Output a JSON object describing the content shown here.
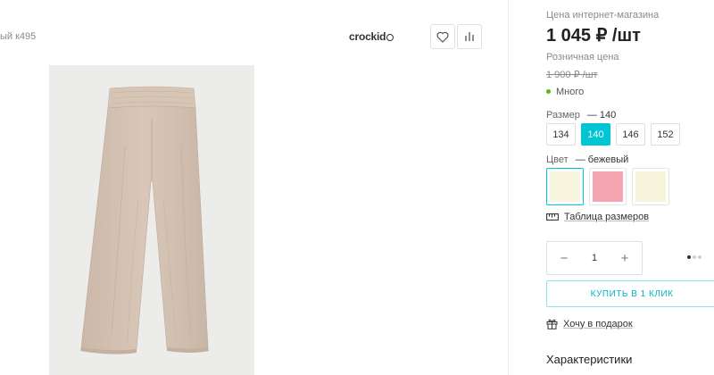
{
  "product": {
    "article_partial": "ый к495",
    "brand": "crockid",
    "image_icon": "beige-wide-pants-photo"
  },
  "actions": {
    "favorite_icon": "heart-icon",
    "compare_icon": "bar-chart-icon"
  },
  "pricing": {
    "online_label": "Цена интернет-магазина",
    "online_price": "1 045 ₽ /шт",
    "retail_label": "Розничная цена",
    "retail_price": "1 900 ₽ /шт"
  },
  "stock": {
    "text": "Много",
    "color": "#55b81c"
  },
  "size": {
    "label": "Размер",
    "selected": "— 140",
    "options": [
      "134",
      "140",
      "146",
      "152"
    ],
    "active_index": 1
  },
  "color": {
    "label": "Цвет",
    "selected": "— бежевый",
    "swatches": [
      "#f8f6df",
      "#f4a5b1",
      "#f7f4dc"
    ],
    "active_index": 0
  },
  "size_table": {
    "label": "Таблица размеров",
    "icon": "ruler-icon"
  },
  "quantity": {
    "minus": "−",
    "value": "1",
    "plus": "+"
  },
  "buy": {
    "label": "КУПИТЬ В 1 КЛИК"
  },
  "gift": {
    "label": "Хочу в подарок",
    "icon": "gift-icon"
  },
  "specs": {
    "title": "Характеристики"
  },
  "colors": {
    "accent": "#00c5d4",
    "buy_border": "#8fe3ea",
    "buy_text": "#00b5c5"
  }
}
